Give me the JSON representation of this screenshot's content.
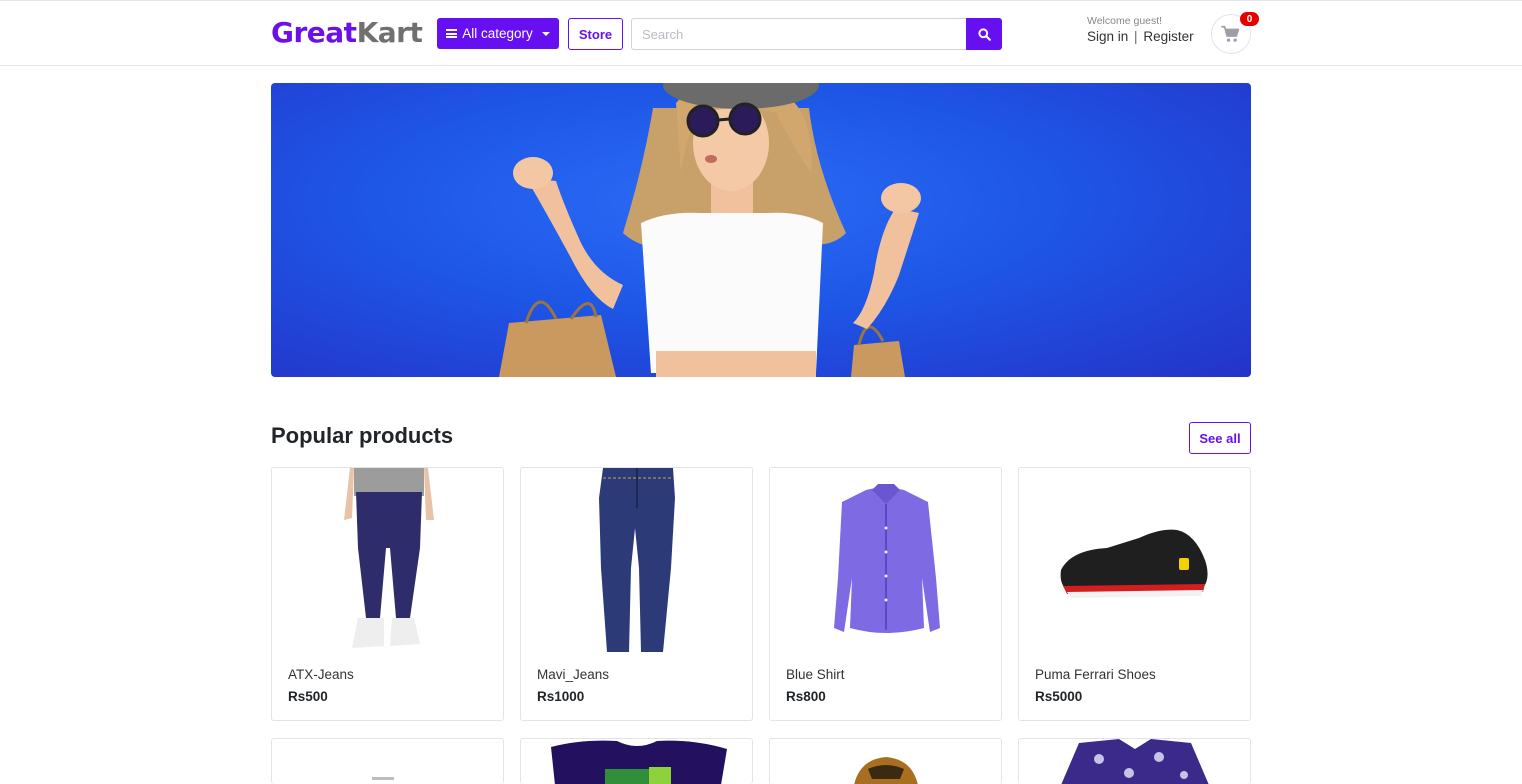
{
  "header": {
    "logo_part1": "Great",
    "logo_part2": "Kart",
    "category_button": "All category",
    "store_button": "Store",
    "search_placeholder": "Search",
    "welcome_text": "Welcome guest!",
    "sign_in": "Sign in",
    "separator": "|",
    "register": "Register",
    "cart_count": "0",
    "accent_color": "#6610f2"
  },
  "banner": {
    "icon": "banner-woman-shopping-image"
  },
  "section": {
    "title": "Popular products",
    "see_all": "See all"
  },
  "products": [
    {
      "name": "ATX-Jeans",
      "price": "Rs500",
      "icon": "jeans-model-image"
    },
    {
      "name": "Mavi_Jeans",
      "price": "Rs1000",
      "icon": "jeans-image"
    },
    {
      "name": "Blue Shirt",
      "price": "Rs800",
      "icon": "shirt-image"
    },
    {
      "name": "Puma Ferrari Shoes",
      "price": "Rs5000",
      "icon": "shoe-image"
    }
  ]
}
